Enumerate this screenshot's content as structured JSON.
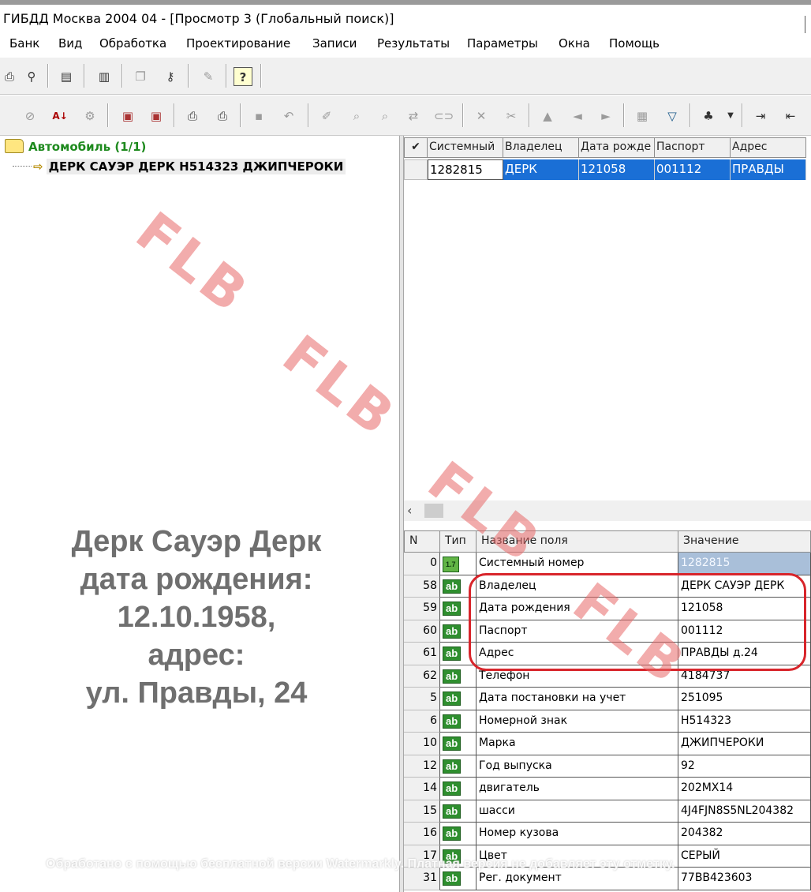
{
  "window": {
    "title": "ГИБДД Москва 2004 04 - [Просмотр 3 (Глобальный поиск)]"
  },
  "menu": [
    "Банк",
    "Вид",
    "Обработка",
    "Проектирование",
    "Записи",
    "Результаты",
    "Параметры",
    "Окна",
    "Помощь"
  ],
  "toolbar1": [
    "print-preview-icon",
    "binoculars-icon",
    "edit-form-icon",
    "chart-icon",
    "copy-icon",
    "key-icon",
    "pencil-icon",
    "help-icon"
  ],
  "toolbar2": [
    "cancel-icon",
    "sort-az-icon",
    "filter-fields-icon",
    "export-icon",
    "import-icon",
    "print-icon",
    "print-setup-icon",
    "save-icon",
    "undo-icon",
    "new-record-icon",
    "search-icon",
    "find-all-icon",
    "replace-icon",
    "link-icon",
    "delete-icon",
    "cut-icon",
    "up-arrow-icon",
    "left-arrow-icon",
    "right-arrow-icon",
    "report-icon",
    "filter-icon",
    "tree-icon",
    "insert-row-icon",
    "delete-row-icon"
  ],
  "tree": {
    "root_label": "Автомобиль (1/1)",
    "child_label": "ДЕРК САУЭР ДЕРК Н514323 ДЖИПЧЕРОКИ"
  },
  "caption": [
    "Дерк Сауэр Дерк",
    "дата рождения:",
    "12.10.1958,",
    "адрес:",
    "ул. Правды, 24"
  ],
  "grid": {
    "columns": [
      "Системный",
      "Владелец",
      "Дата рожде",
      "Паспорт",
      "Адрес"
    ],
    "row": [
      "1282815",
      "ДЕРК",
      "121058",
      "001112",
      "ПРАВДЫ"
    ]
  },
  "fields": {
    "headers": {
      "n": "N",
      "type": "Тип",
      "name": "Название поля",
      "value": "Значение"
    },
    "rows": [
      {
        "n": "0",
        "type": "1.7",
        "name": "Системный номер",
        "value": "1282815"
      },
      {
        "n": "58",
        "type": "ab",
        "name": "Владелец",
        "value": "ДЕРК САУЭР ДЕРК"
      },
      {
        "n": "59",
        "type": "ab",
        "name": "Дата рождения",
        "value": "121058"
      },
      {
        "n": "60",
        "type": "ab",
        "name": "Паспорт",
        "value": "001112"
      },
      {
        "n": "61",
        "type": "ab",
        "name": "Адрес",
        "value": "ПРАВДЫ д.24"
      },
      {
        "n": "62",
        "type": "ab",
        "name": "Телефон",
        "value": "4184737"
      },
      {
        "n": "5",
        "type": "ab",
        "name": "Дата постановки на учет",
        "value": "251095"
      },
      {
        "n": "6",
        "type": "ab",
        "name": "Номерной знак",
        "value": "Н514323"
      },
      {
        "n": "10",
        "type": "ab",
        "name": "Марка",
        "value": "ДЖИПЧЕРОКИ"
      },
      {
        "n": "12",
        "type": "ab",
        "name": "Год выпуска",
        "value": "92"
      },
      {
        "n": "14",
        "type": "ab",
        "name": "двигатель",
        "value": "202МХ14"
      },
      {
        "n": "15",
        "type": "ab",
        "name": "шасси",
        "value": "4J4FJN8S5NL204382"
      },
      {
        "n": "16",
        "type": "ab",
        "name": "Номер кузова",
        "value": "204382"
      },
      {
        "n": "17",
        "type": "ab",
        "name": "Цвет",
        "value": "СЕРЫЙ"
      },
      {
        "n": "31",
        "type": "ab",
        "name": "Рег. документ",
        "value": "77ВВ423603"
      }
    ]
  },
  "watermarks": {
    "text": "FLB",
    "footer": "Обработано с помощью бесплатной версии Watermarkly. Платная версия не добавляет эту отметку."
  },
  "colors": {
    "selection": "#1a6fd6",
    "highlight_ring": "#d8252b",
    "watermark": "#e86868",
    "tree_root": "#1e8a1e",
    "type_badge": "#2f8f2f"
  }
}
